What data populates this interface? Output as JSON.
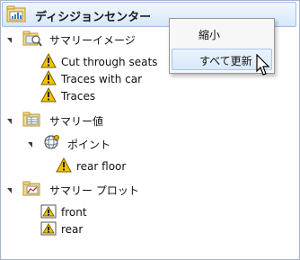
{
  "panel": {
    "title": "ディシジョンセンター",
    "title_icon": "decision-center-icon"
  },
  "tree": {
    "summary_image": {
      "label": "サマリーイメージ",
      "icon": "image-folder-icon",
      "items": [
        {
          "label": "Cut through seats",
          "icon": "warning-icon"
        },
        {
          "label": "Traces with car",
          "icon": "warning-icon"
        },
        {
          "label": "Traces",
          "icon": "warning-icon"
        }
      ]
    },
    "summary_value": {
      "label": "サマリー値",
      "icon": "values-folder-icon",
      "point": {
        "label": "ポイント",
        "icon": "point-icon",
        "items": [
          {
            "label": "rear floor",
            "icon": "warning-icon"
          }
        ]
      }
    },
    "summary_plot": {
      "label": "サマリー プロット",
      "icon": "plot-folder-icon",
      "items": [
        {
          "label": "front",
          "icon": "plot-warning-icon"
        },
        {
          "label": "rear",
          "icon": "plot-warning-icon"
        }
      ]
    }
  },
  "context_menu": {
    "items": [
      {
        "label": "縮小"
      },
      {
        "label": "すべて更新"
      }
    ],
    "highlighted_index": 1
  },
  "colors": {
    "header_gradient_top": "#f1f7fe",
    "header_gradient_bottom": "#d7e7fb",
    "warning_yellow": "#f2c200",
    "menu_highlight": "#d9e9fb"
  }
}
